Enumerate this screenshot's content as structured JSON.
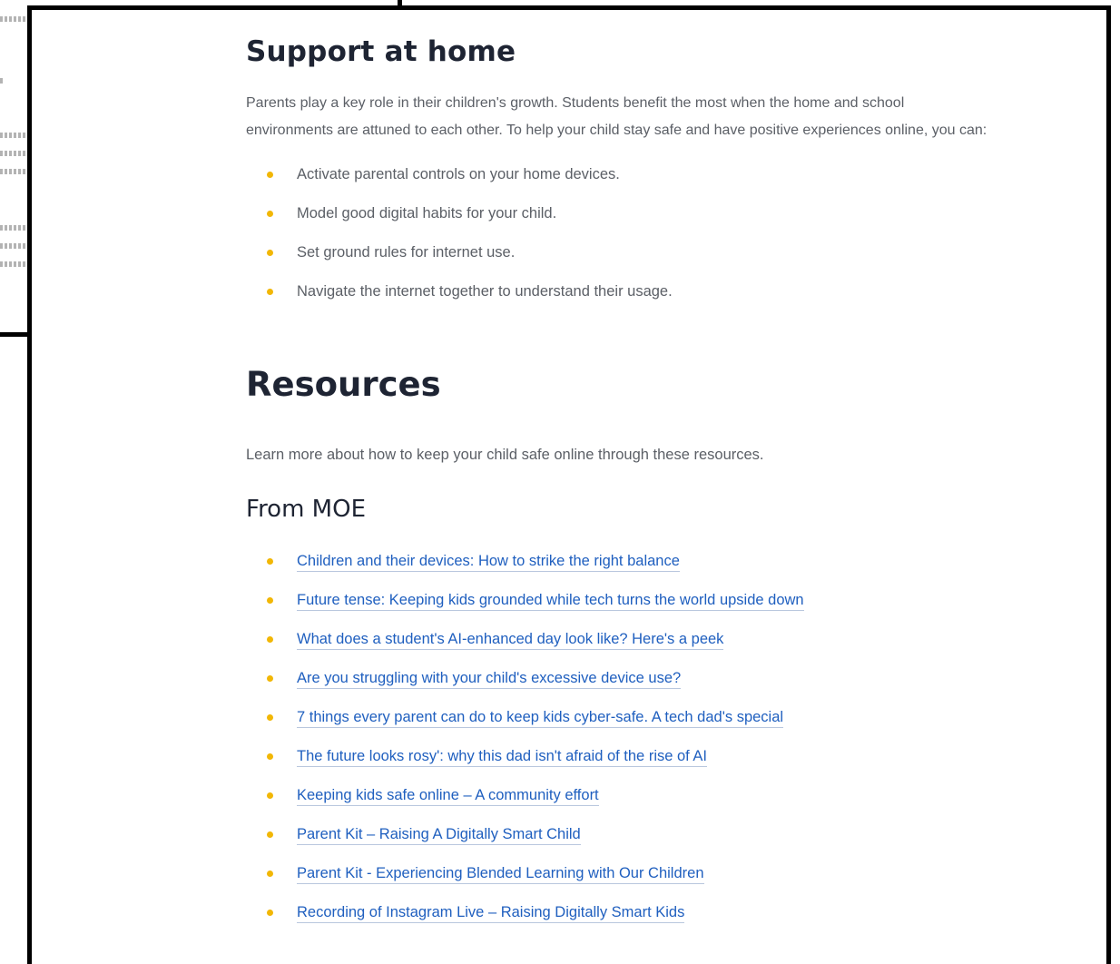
{
  "support": {
    "heading": "Support at home",
    "intro": "Parents play a key role in their children's growth. Students benefit the most when the home and school environments are attuned to each other. To help your child stay safe and have positive experiences online, you can:",
    "tips": [
      "Activate parental controls on your home devices.",
      "Model good digital habits for your child.",
      "Set ground rules for internet use.",
      "Navigate the internet together to understand their usage."
    ]
  },
  "resources": {
    "heading": "Resources",
    "intro": "Learn more about how to keep your child safe online through these resources.",
    "moe": {
      "heading": "From MOE",
      "links": [
        "Children and their devices: How to strike the right balance",
        "Future tense: Keeping kids grounded while tech turns the world upside down",
        "What does a student's AI-enhanced day look like? Here's a peek",
        "Are you struggling with your child's excessive device use?",
        "7 things every parent can do to keep kids cyber-safe. A tech dad's special",
        "The future looks rosy': why this dad isn't afraid of the rise of AI",
        "Keeping kids safe online – A community effort",
        "Parent Kit – Raising A Digitally Smart Child",
        "Parent Kit - Experiencing Blended Learning with Our Children",
        "Recording of Instagram Live – Raising Digitally Smart Kids"
      ]
    }
  },
  "colors": {
    "bullet": "#f2b705",
    "link": "#1f5fbf",
    "heading": "#1e2433",
    "body_text": "#5b5f66",
    "frame": "#000000"
  }
}
